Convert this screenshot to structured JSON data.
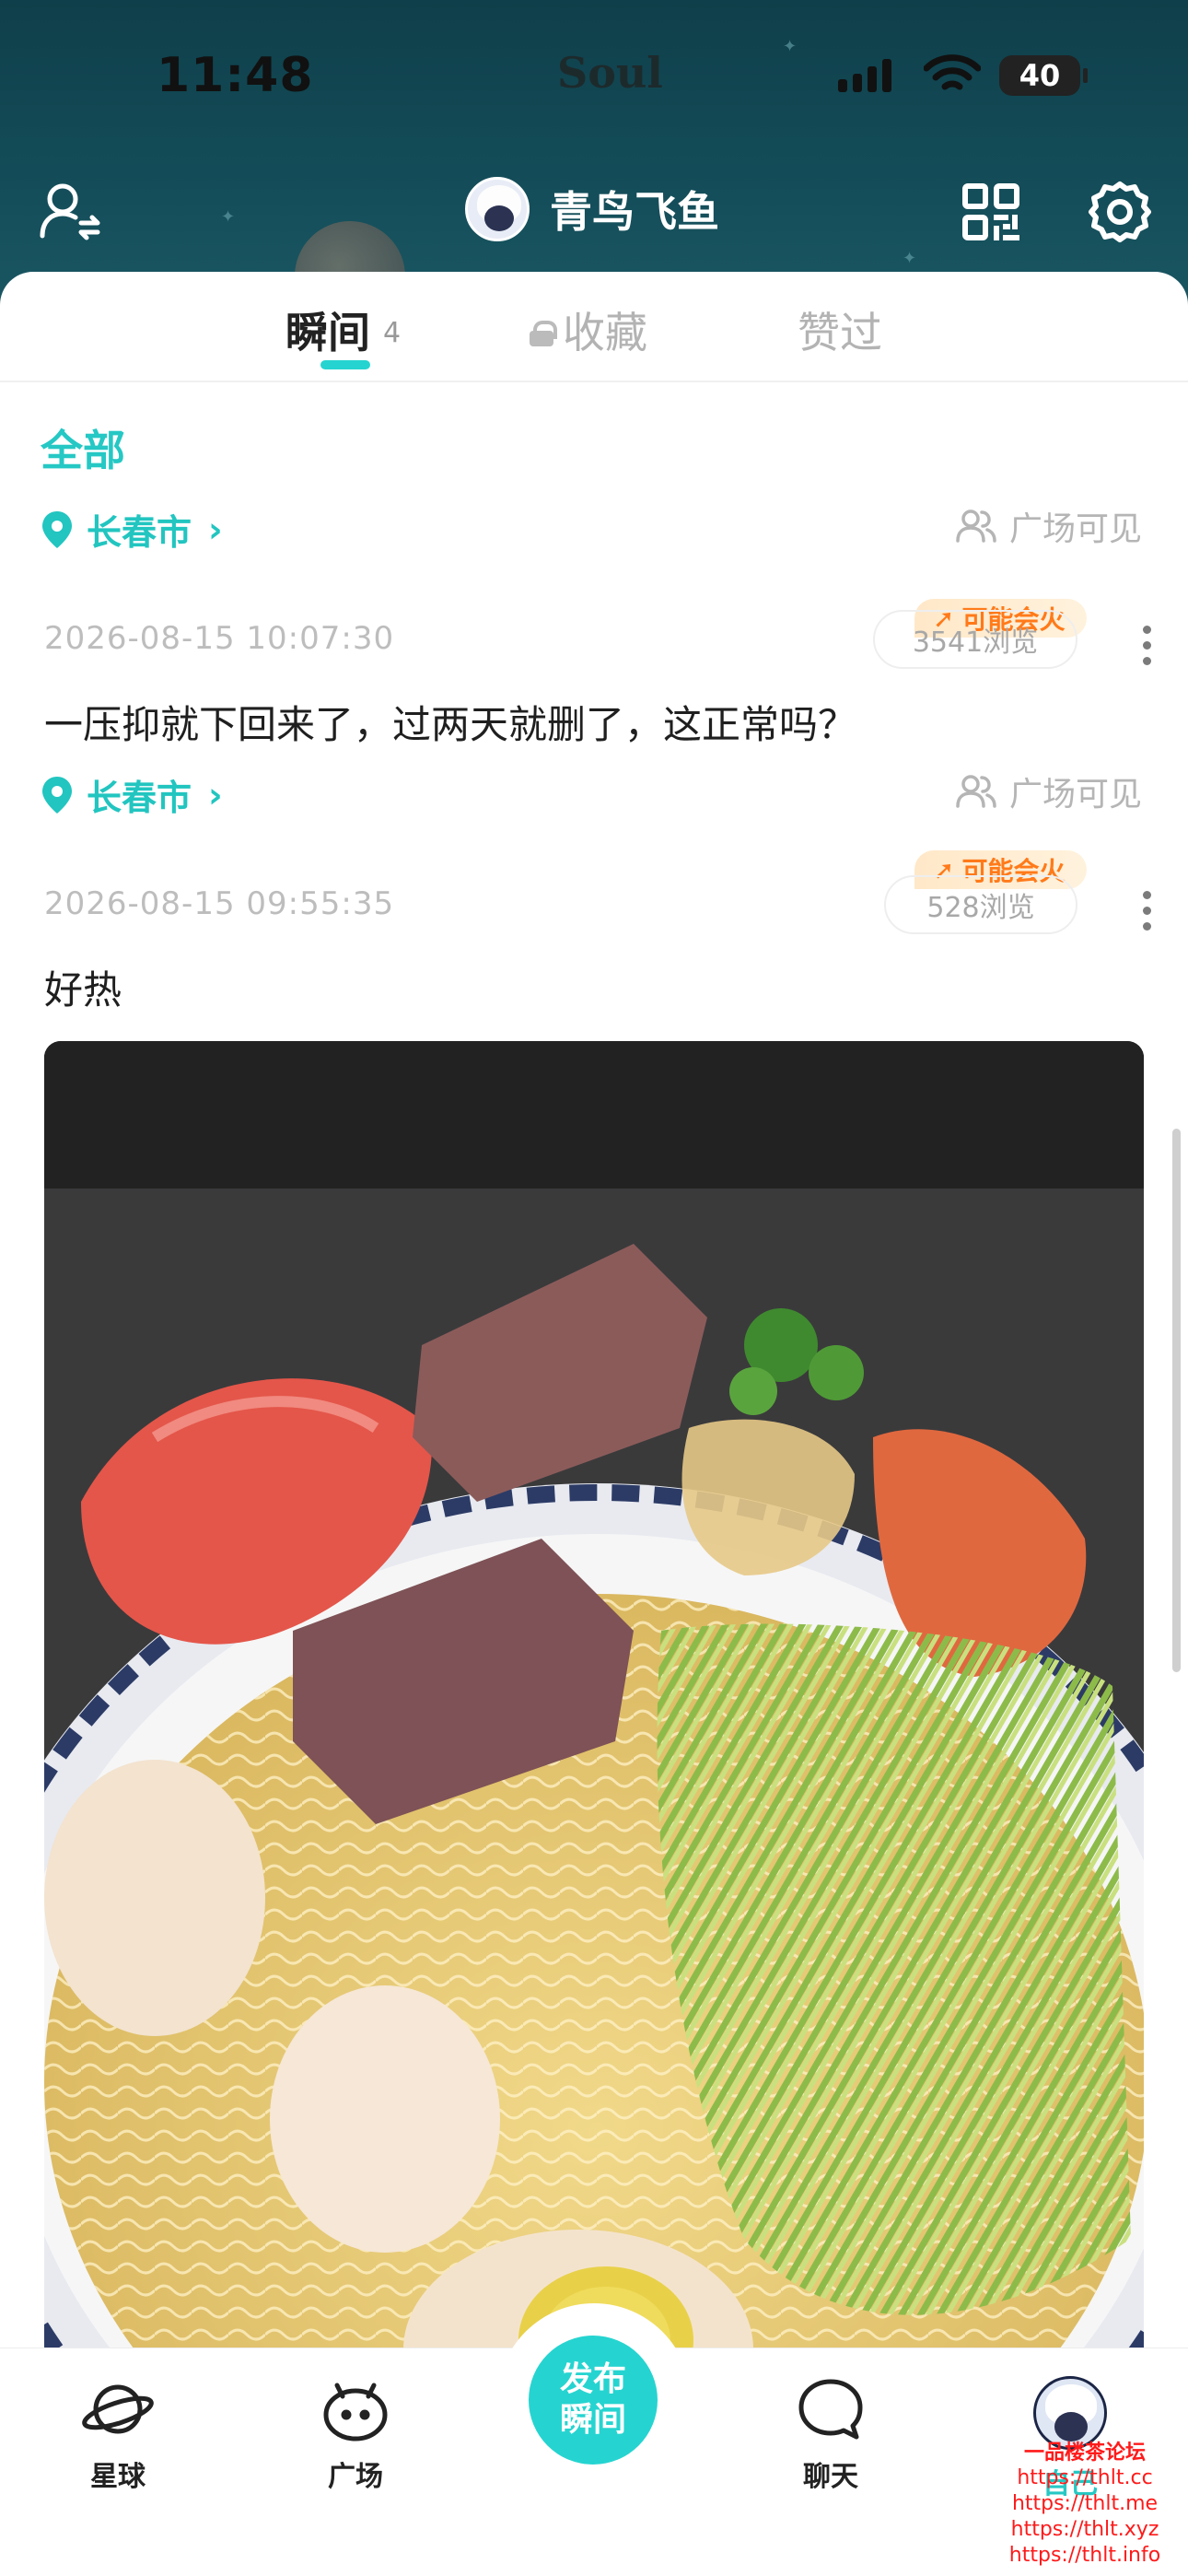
{
  "status_bar": {
    "time": "11:48",
    "carrier_logo": "Soul",
    "battery": "40"
  },
  "header": {
    "username": "青鸟飞鱼",
    "icons": [
      "user-switch-icon",
      "qr-code-icon",
      "gear-icon"
    ]
  },
  "tabs": [
    {
      "label": "瞬间",
      "count": "4",
      "active": true
    },
    {
      "label": "收藏",
      "locked": true
    },
    {
      "label": "赞过"
    }
  ],
  "filter": {
    "label": "全部"
  },
  "location_top": {
    "city": "长春市",
    "visibility": "广场可见"
  },
  "posts": [
    {
      "timestamp": "2026-08-15 10:07:30",
      "badge": "可能会火",
      "views": "3541浏览",
      "text": "一压抑就下回来了，过两天就删了，这正常吗？",
      "city": "长春市",
      "visibility": "广场可见"
    },
    {
      "timestamp": "2026-08-15 09:55:35",
      "badge": "可能会火",
      "views": "528浏览",
      "text": "好热",
      "image": "cold-noodle-bowl-photo"
    }
  ],
  "bottom_nav": {
    "items": [
      {
        "label": "星球",
        "icon": "planet-icon"
      },
      {
        "label": "广场",
        "icon": "square-icon"
      },
      {
        "label": "聊天",
        "icon": "chat-icon"
      },
      {
        "label": "自己",
        "icon": "avatar"
      }
    ],
    "publish_line1": "发布",
    "publish_line2": "瞬间"
  },
  "watermark": {
    "title": "一品楼茶论坛",
    "links": [
      "https://thlt.cc",
      "https://thlt.me",
      "https://thlt.xyz",
      "https://thlt.info"
    ]
  },
  "colors": {
    "accent": "#25d4d0",
    "header_bg": "#134c58",
    "hot_badge": "#ff7a1a"
  }
}
